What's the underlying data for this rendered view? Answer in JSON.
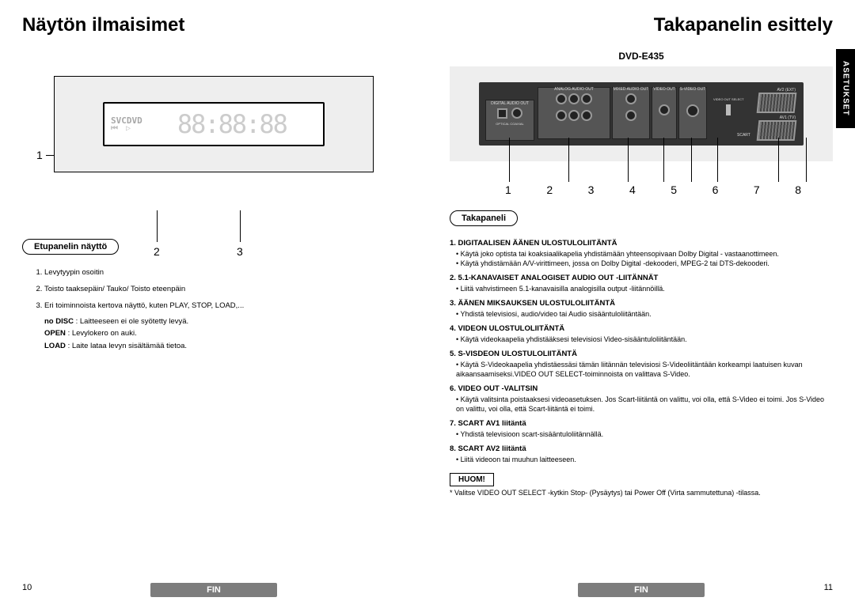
{
  "left": {
    "title": "Näytön ilmaisimet",
    "callout1": "1",
    "callout2": "2",
    "callout3": "3",
    "lcd_disc_row1": "SVCDVD",
    "lcd_disc_row2": "⏮ ▷",
    "subheading": "Etupanelin näyttö",
    "items": [
      {
        "text": "Levytyypin osoitin"
      },
      {
        "text": "Toisto taaksepäin/ Tauko/ Toisto eteenpäin"
      },
      {
        "text": "Eri toiminnoista kertova näyttö, kuten PLAY, STOP, LOAD,..."
      }
    ],
    "sub": [
      {
        "b": "no DISC",
        "t": ": Laitteeseen ei ole syötetty levyä."
      },
      {
        "b": "OPEN",
        "t": ": Levylokero on auki."
      },
      {
        "b": "LOAD",
        "t": ": Laite lataa levyn sisältämää tietoa."
      }
    ],
    "page": "10",
    "lang": "FIN"
  },
  "right": {
    "title": "Takapanelin esittely",
    "sidetab": "ASETUKSET",
    "model": "DVD-E435",
    "panel_labels": {
      "digital_audio_out": "DIGITAL AUDIO OUT",
      "analog_audio_out": "ANALOG AUDIO OUT",
      "mixed_audio_out": "MIXED AUDIO OUT",
      "video_out": "VIDEO OUT",
      "svideo_out": "S-VIDEO OUT",
      "optical": "OPTICAL",
      "coaxial": "COAXIAL",
      "video_out_select": "VIDEO OUT SELECT",
      "scart": "SCART",
      "av2": "AV2 (EXT)",
      "av1": "AV1 (TV)"
    },
    "callouts": [
      "1",
      "2",
      "3",
      "4",
      "5",
      "6",
      "7",
      "8"
    ],
    "subheading": "Takapaneli",
    "items": [
      {
        "title": "1. DIGITAALISEN ÄÄNEN ULOSTULOLIITÄNTÄ",
        "descs": [
          "Käytä joko optista tai koaksiaalikapelia yhdistämään yhteensopivaan Dolby Digital - vastaanottimeen.",
          "Käytä yhdistämään A/V-virittimeen, jossa on Dolby Digital -dekooderi, MPEG-2 tai DTS-dekooderi."
        ]
      },
      {
        "title": "2. 5.1-KANAVAISET ANALOGISET AUDIO OUT -LIITÄNNÄT",
        "descs": [
          "Liitä vahvistimeen 5.1-kanavaisilla analogisilla output -liitännöillä."
        ]
      },
      {
        "title": "3. ÄÄNEN MIKSAUKSEN ULOSTULOLIITÄNTÄ",
        "descs": [
          "Yhdistä televisiosi, audio/video tai Audio sisääntuloliitäntään."
        ]
      },
      {
        "title": "4. VIDEON ULOSTULOLIITÄNTÄ",
        "descs": [
          "Käytä videokaapelia yhdistääksesi televisiosi Video-sisääntuloliitäntään."
        ]
      },
      {
        "title": "5. S-VISDEON ULOSTULOLIITÄNTÄ",
        "descs": [
          "Käytä S-Videokaapelia yhdistäessäsi tämän liitännän televisiosi S-Videoliitäntään korkeampi laatuisen kuvan aikaansaamiseksi.VIDEO OUT SELECT-toiminnoista on valittava S-Video."
        ]
      },
      {
        "title": "6. VIDEO OUT -VALITSIN",
        "descs": [
          "Käytä valitsinta poistaaksesi videoasetuksen. Jos Scart-liitäntä on valittu, voi olla, että S-Video ei toimi. Jos S-Video on valittu, voi olla, että Scart-liitäntä ei toimi."
        ]
      },
      {
        "title": "7. SCART AV1 liitäntä",
        "descs": [
          "Yhdistä televisioon scart-sisääntuloliitännällä."
        ]
      },
      {
        "title": "8. SCART AV2 liitäntä",
        "descs": [
          "Liitä videoon tai muuhun laitteeseen."
        ]
      }
    ],
    "note_label": "HUOM!",
    "note_text": "Valitse VIDEO OUT SELECT -kytkin Stop- (Pysäytys) tai Power Off (Virta sammutettuna) -tilassa.",
    "page": "11",
    "lang": "FIN"
  }
}
